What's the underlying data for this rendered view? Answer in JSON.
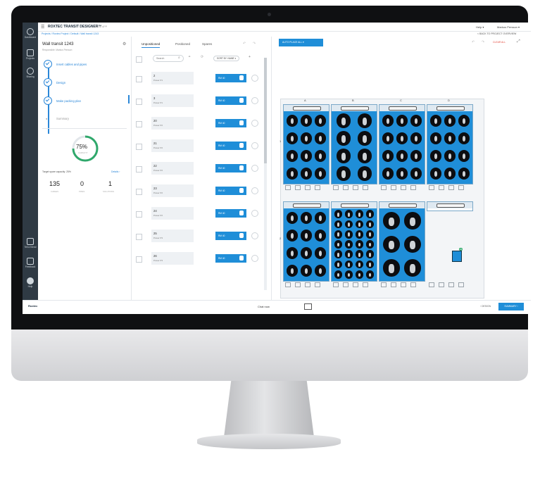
{
  "app": {
    "brand": "ROXTEC TRANSIT DESIGNER™",
    "version": "CLOUD APP",
    "footer_brand": "Roxtec"
  },
  "topbar": {
    "help": "Help ▾",
    "user": "Markus Persson ▾"
  },
  "breadcrumb": {
    "path": "Projects / Roxtec Project / Default / Wall transit 1243",
    "back": "< BACK TO PROJECT OVERVIEW"
  },
  "sidebar": {
    "items": [
      {
        "label": "Dashboard",
        "icon": "dashboard-icon"
      },
      {
        "label": "Projects",
        "icon": "projects-icon"
      },
      {
        "label": "Sharing",
        "icon": "sharing-icon"
      },
      {
        "label": "Tell a friend",
        "icon": "chat-icon"
      },
      {
        "label": "Feedback",
        "icon": "feedback-icon"
      },
      {
        "label": "Help",
        "icon": "help-icon"
      }
    ]
  },
  "transit": {
    "title": "Wall transit 1243",
    "owner": "Responsible: Markus Persson"
  },
  "steps": [
    {
      "label": "Insert cables and pipes"
    },
    {
      "label": "Design"
    },
    {
      "label": "Make packing plan"
    },
    {
      "label": "Summary"
    }
  ],
  "capacity": {
    "percent": "75%",
    "sublabel": "CAPACITY",
    "target": "Target spare capacity: 25%",
    "details": "Details ›"
  },
  "counts": [
    {
      "value": "135",
      "label": "CABLES"
    },
    {
      "value": "0",
      "label": "PIPES"
    },
    {
      "value": "1",
      "label": "SOLUTIONS"
    }
  ],
  "tabs": [
    "Unpositioned",
    "Positioned",
    "Spares"
  ],
  "search": {
    "placeholder": "Search"
  },
  "sort_label": "SORT BY: NAME ▾",
  "rows": [
    {
      "num": "2",
      "sub": "Power P1",
      "btn": "RM 40"
    },
    {
      "num": "3",
      "sub": "Power P1",
      "btn": "RM 40"
    },
    {
      "num": "20",
      "sub": "Power P2",
      "btn": "RM 40"
    },
    {
      "num": "21",
      "sub": "Power P2",
      "btn": "RM 40"
    },
    {
      "num": "22",
      "sub": "Power P2",
      "btn": "RM 40"
    },
    {
      "num": "23",
      "sub": "Power P2",
      "btn": "RM 40"
    },
    {
      "num": "24",
      "sub": "Power P2",
      "btn": "RM 40"
    },
    {
      "num": "25",
      "sub": "Power P3",
      "btn": "RM 40"
    },
    {
      "num": "26",
      "sub": "Power P3",
      "btn": "RM 40"
    }
  ],
  "plan": {
    "auto_place": "AUTO PLACE ALL ▾",
    "clear_all": "CLEAR ALL",
    "columns": [
      "A",
      "B",
      "C",
      "D"
    ],
    "rows": [
      "1",
      "2"
    ],
    "badge": "22"
  },
  "bottom": {
    "chat": "Chat now",
    "back": "‹ DESIGN",
    "submit": "SUMMARY ›"
  },
  "colors": {
    "accent": "#1f8ed8",
    "sidebar": "#2f3a44",
    "danger": "#e2473b",
    "progress": "#2fa86b"
  }
}
